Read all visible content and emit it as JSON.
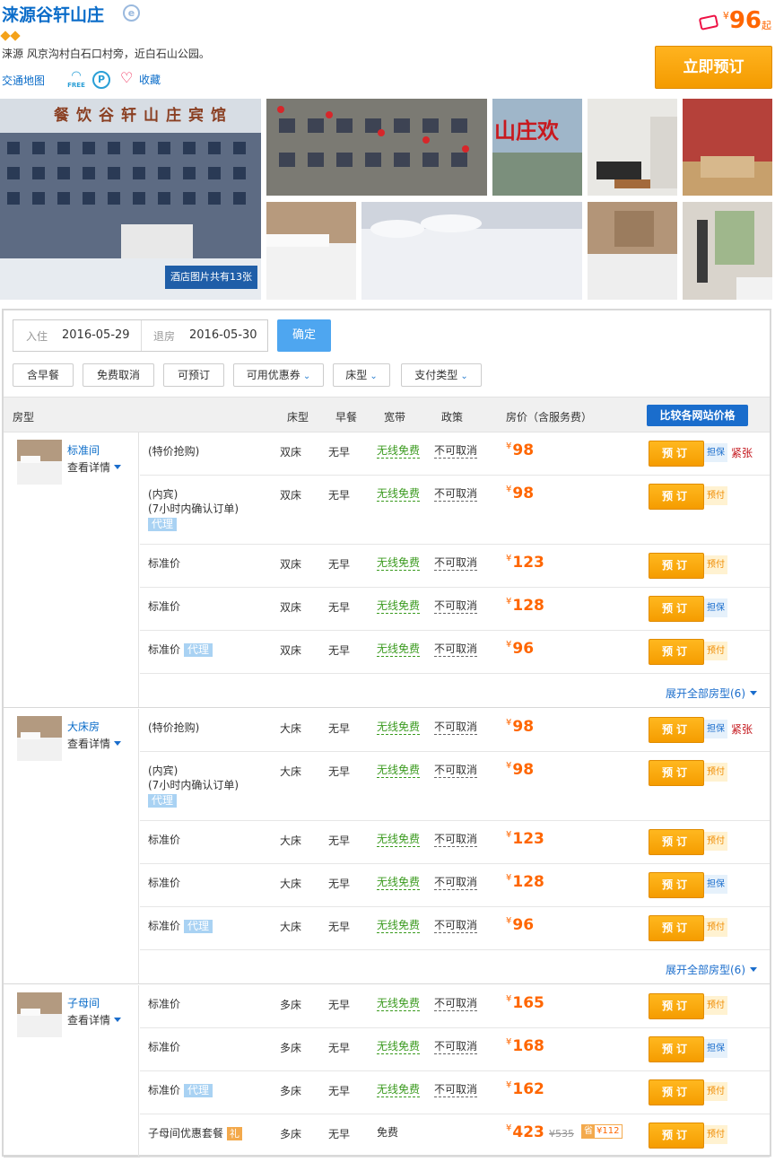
{
  "hotel": {
    "name": "涞源谷轩山庄",
    "address": "涞源 风京沟村白石口村旁，近白石山公园。",
    "map_link": "交通地图",
    "wifi_free": "FREE",
    "parking_label": "P",
    "favorite": "收藏",
    "price_symbol": "¥",
    "price_from": "96",
    "price_suffix": "起",
    "book_now": "立即预订",
    "photo_count": "酒店图片共有13张"
  },
  "search": {
    "checkin_label": "入住",
    "checkin_date": "2016-05-29",
    "checkout_label": "退房",
    "checkout_date": "2016-05-30",
    "confirm": "确定"
  },
  "filters": [
    {
      "label": "含早餐",
      "dropdown": false
    },
    {
      "label": "免费取消",
      "dropdown": false
    },
    {
      "label": "可预订",
      "dropdown": false
    },
    {
      "label": "可用优惠券",
      "dropdown": true
    },
    {
      "label": "床型",
      "dropdown": true
    },
    {
      "label": "支付类型",
      "dropdown": true
    }
  ],
  "table_headers": {
    "room_type": "房型",
    "bed": "床型",
    "breakfast": "早餐",
    "internet": "宽带",
    "policy": "政策",
    "price": "房价（含服务费）",
    "compare": "比较各网站价格"
  },
  "common": {
    "view_details": "查看详情",
    "book": "预订",
    "yen": "¥",
    "agent_tag": "代理"
  },
  "room_groups": [
    {
      "name": "标准间",
      "expand": "展开全部房型(6)",
      "rates": [
        {
          "name": "(特价抢购)",
          "bed": "双床",
          "breakfast": "无早",
          "internet": "无线免费",
          "policy": "不可取消",
          "price": "98",
          "pay": "担保",
          "urgent": "紧张"
        },
        {
          "name": "(内宾)",
          "name2": "(7小时内确认订单)",
          "agent_block": true,
          "bed": "双床",
          "breakfast": "无早",
          "internet": "无线免费",
          "policy": "不可取消",
          "price": "98",
          "pay": "预付"
        },
        {
          "name": "标准价",
          "bed": "双床",
          "breakfast": "无早",
          "internet": "无线免费",
          "policy": "不可取消",
          "price": "123",
          "pay": "预付"
        },
        {
          "name": "标准价",
          "bed": "双床",
          "breakfast": "无早",
          "internet": "无线免费",
          "policy": "不可取消",
          "price": "128",
          "pay": "担保"
        },
        {
          "name": "标准价",
          "agent_inline": true,
          "bed": "双床",
          "breakfast": "无早",
          "internet": "无线免费",
          "policy": "不可取消",
          "price": "96",
          "pay": "预付"
        }
      ]
    },
    {
      "name": "大床房",
      "expand": "展开全部房型(6)",
      "rates": [
        {
          "name": "(特价抢购)",
          "bed": "大床",
          "breakfast": "无早",
          "internet": "无线免费",
          "policy": "不可取消",
          "price": "98",
          "pay": "担保",
          "urgent": "紧张"
        },
        {
          "name": "(内宾)",
          "name2": "(7小时内确认订单)",
          "agent_block": true,
          "bed": "大床",
          "breakfast": "无早",
          "internet": "无线免费",
          "policy": "不可取消",
          "price": "98",
          "pay": "预付"
        },
        {
          "name": "标准价",
          "bed": "大床",
          "breakfast": "无早",
          "internet": "无线免费",
          "policy": "不可取消",
          "price": "123",
          "pay": "预付"
        },
        {
          "name": "标准价",
          "bed": "大床",
          "breakfast": "无早",
          "internet": "无线免费",
          "policy": "不可取消",
          "price": "128",
          "pay": "担保"
        },
        {
          "name": "标准价",
          "agent_inline": true,
          "bed": "大床",
          "breakfast": "无早",
          "internet": "无线免费",
          "policy": "不可取消",
          "price": "96",
          "pay": "预付"
        }
      ]
    },
    {
      "name": "子母间",
      "expand": "",
      "rates": [
        {
          "name": "标准价",
          "bed": "多床",
          "breakfast": "无早",
          "internet": "无线免费",
          "policy": "不可取消",
          "price": "165",
          "pay": "预付"
        },
        {
          "name": "标准价",
          "bed": "多床",
          "breakfast": "无早",
          "internet": "无线免费",
          "policy": "不可取消",
          "price": "168",
          "pay": "担保"
        },
        {
          "name": "标准价",
          "agent_inline": true,
          "bed": "多床",
          "breakfast": "无早",
          "internet": "无线免费",
          "policy": "不可取消",
          "price": "162",
          "pay": "预付"
        },
        {
          "name": "子母间优惠套餐",
          "gift_tag": "礼",
          "bed": "多床",
          "breakfast": "无早",
          "internet": "免费",
          "internet_plain": true,
          "policy": "",
          "price": "423",
          "orig_price": "¥535",
          "save_label": "省",
          "save_amount": "¥112",
          "pay": "预付"
        }
      ]
    }
  ]
}
